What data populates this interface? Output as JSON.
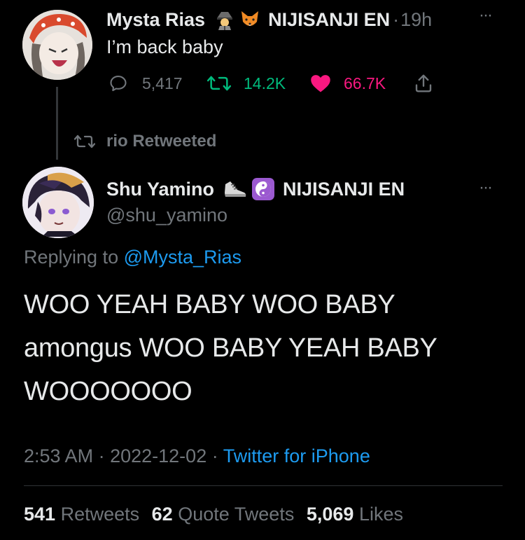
{
  "tweet_top": {
    "display_name": "Mysta Rias",
    "org": "NIJISANJI EN",
    "separator": "·",
    "time": "19h",
    "text": "I’m back baby",
    "replies": "5,417",
    "retweets": "14.2K",
    "likes": "66.7K",
    "more": "···",
    "emojis": [
      "detective-emoji",
      "fox-emoji"
    ]
  },
  "retweet_banner": {
    "label": "rio Retweeted"
  },
  "tweet_main": {
    "display_name": "Shu Yamino",
    "org": "NIJISANJI EN",
    "handle": "@shu_yamino",
    "more": "···",
    "replying_prefix": "Replying to ",
    "replying_handle": "@Mysta_Rias",
    "text_line1": "WOO YEAH BABY WOO BABY",
    "text_line2": "amongus WOO BABY YEAH BABY",
    "text_line3": "WOOOOOOO",
    "time": "2:53 AM",
    "dot1": "·",
    "date": "2022-12-02",
    "dot2": "·",
    "source": "Twitter for iPhone",
    "emojis": [
      "sneaker-emoji",
      "yin-yang-emoji"
    ]
  },
  "stats": {
    "retweets_count": "541",
    "retweets_label": "Retweets",
    "quotes_count": "62",
    "quotes_label": "Quote Tweets",
    "likes_count": "5,069",
    "likes_label": "Likes"
  },
  "colors": {
    "background": "#000000",
    "text": "#e7e9ea",
    "muted": "#71767b",
    "link": "#1d9bf0",
    "retweet_green": "#00ba7c",
    "like_pink": "#f91880"
  }
}
